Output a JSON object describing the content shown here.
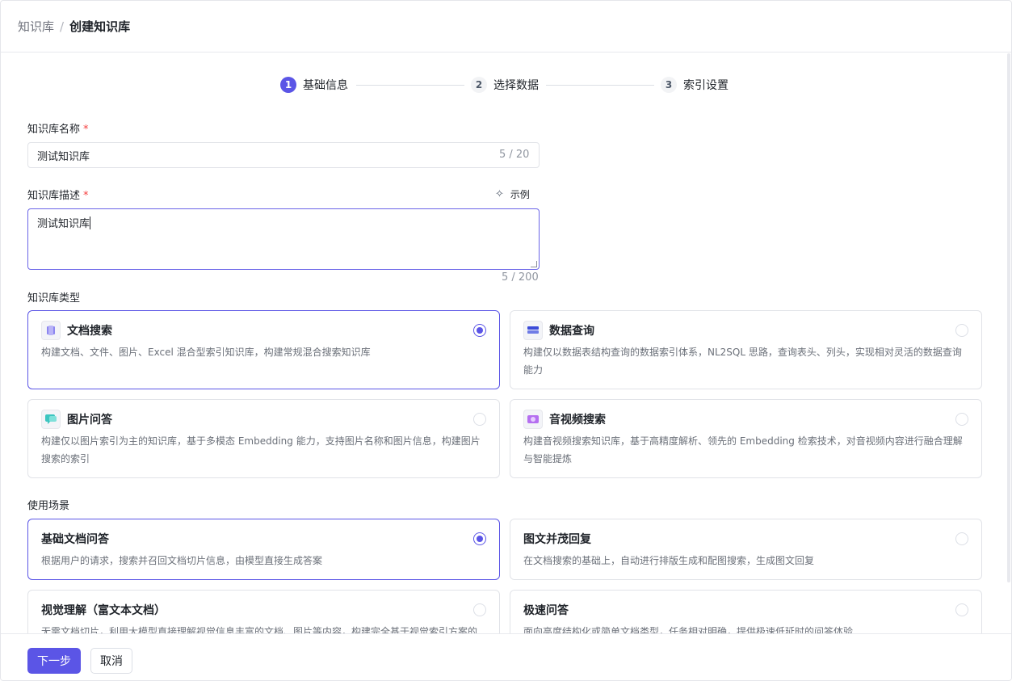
{
  "breadcrumb": {
    "parent": "知识库",
    "separator": "/",
    "current": "创建知识库"
  },
  "steps": [
    {
      "num": "1",
      "label": "基础信息",
      "state": "active"
    },
    {
      "num": "2",
      "label": "选择数据",
      "state": "inactive"
    },
    {
      "num": "3",
      "label": "索引设置",
      "state": "inactive"
    }
  ],
  "form": {
    "name": {
      "label": "知识库名称",
      "required": "*",
      "value": "测试知识库",
      "counter": "5 / 20"
    },
    "description": {
      "label": "知识库描述",
      "required": "*",
      "value": "测试知识库",
      "counter": "5 / 200",
      "example_label": "示例"
    },
    "type_label": "知识库类型",
    "types": [
      {
        "title": "文档搜索",
        "desc": "构建文档、文件、图片、Excel 混合型索引知识库，构建常规混合搜索知识库",
        "selected": true,
        "icon": "document-icon"
      },
      {
        "title": "数据查询",
        "desc": "构建仅以数据表结构查询的数据索引体系，NL2SQL 思路，查询表头、列头，实现相对灵活的数据查询能力",
        "selected": false,
        "icon": "database-icon"
      },
      {
        "title": "图片问答",
        "desc": "构建仅以图片索引为主的知识库，基于多模态 Embedding 能力，支持图片名称和图片信息，构建图片搜索的索引",
        "selected": false,
        "icon": "chat-bubble-icon"
      },
      {
        "title": "音视频搜索",
        "desc": "构建音视频搜索知识库，基于高精度解析、领先的 Embedding 检索技术，对音视频内容进行融合理解与智能提炼",
        "selected": false,
        "icon": "video-icon"
      }
    ],
    "scenario_label": "使用场景",
    "scenarios": [
      {
        "title": "基础文档问答",
        "desc": "根据用户的请求，搜索并召回文档切片信息，由模型直接生成答案",
        "selected": true
      },
      {
        "title": "图文并茂回复",
        "desc": "在文档搜索的基础上，自动进行排版生成和配图搜索，生成图文回复",
        "selected": false
      },
      {
        "title": "视觉理解（富文本文档）",
        "desc": "无需文档切片，利用大模型直接理解视觉信息丰富的文档、图片等内容，构建完全基于视觉索引方案的",
        "selected": false
      },
      {
        "title": "极速问答",
        "desc": "面向高度结构化或简单文档类型，任务相对明确，提供极速低延时的问答体验",
        "selected": false
      }
    ]
  },
  "footer": {
    "next_label": "下一步",
    "cancel_label": "取消"
  },
  "colors": {
    "accent": "#5b55e6",
    "required": "#f53f3f"
  }
}
